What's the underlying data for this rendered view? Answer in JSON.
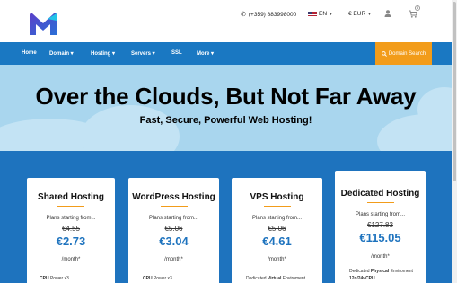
{
  "header": {
    "phone": "(+359) 883998000",
    "language": "EN",
    "currency": "€ EUR",
    "cart_count": "0"
  },
  "nav": {
    "items": [
      {
        "label": "Home"
      },
      {
        "label": "Domain ▾"
      },
      {
        "label": "Hosting ▾"
      },
      {
        "label": "Servers ▾"
      },
      {
        "label": "SSL"
      },
      {
        "label": "More ▾"
      }
    ],
    "search_label": "Domain Search"
  },
  "hero": {
    "title": "Over the Clouds, But Not Far Away",
    "subtitle": "Fast, Secure, Powerful Web Hosting!"
  },
  "cards": [
    {
      "title": "Shared Hosting",
      "plans": "Plans starting from...",
      "old_price": "€4.55",
      "price": "€2.73",
      "period": "/month*",
      "feature_a": "CPU",
      "feature_b": "Power x3"
    },
    {
      "title": "WordPress Hosting",
      "plans": "Plans starting from...",
      "old_price": "€5.06",
      "price": "€3.04",
      "period": "/month*",
      "feature_a": "CPU",
      "feature_b": "Power x3"
    },
    {
      "title": "VPS Hosting",
      "plans": "Plans starting from...",
      "old_price": "€5.06",
      "price": "€4.61",
      "period": "/month*",
      "feature_a": "Dedicated",
      "feature_bold": "Virtual",
      "feature_b": "Enviroment"
    },
    {
      "title": "Dedicated Hosting",
      "plans": "Plans starting from...",
      "old_price": "€127.83",
      "price": "€115.05",
      "period": "/month*",
      "feature_a": "Dedicated",
      "feature_bold": "Physical",
      "feature_b": "Enviroment",
      "feature_c": "12c/24vCPU"
    }
  ],
  "colors": {
    "brand_blue": "#1e73be",
    "nav_blue": "#1a78c2",
    "accent_orange": "#f29c1a",
    "hero_sky": "#a9d6ee"
  },
  "icons": [
    "logo-m-icon",
    "phone-icon",
    "us-flag-icon",
    "user-icon",
    "cart-icon",
    "search-icon"
  ]
}
